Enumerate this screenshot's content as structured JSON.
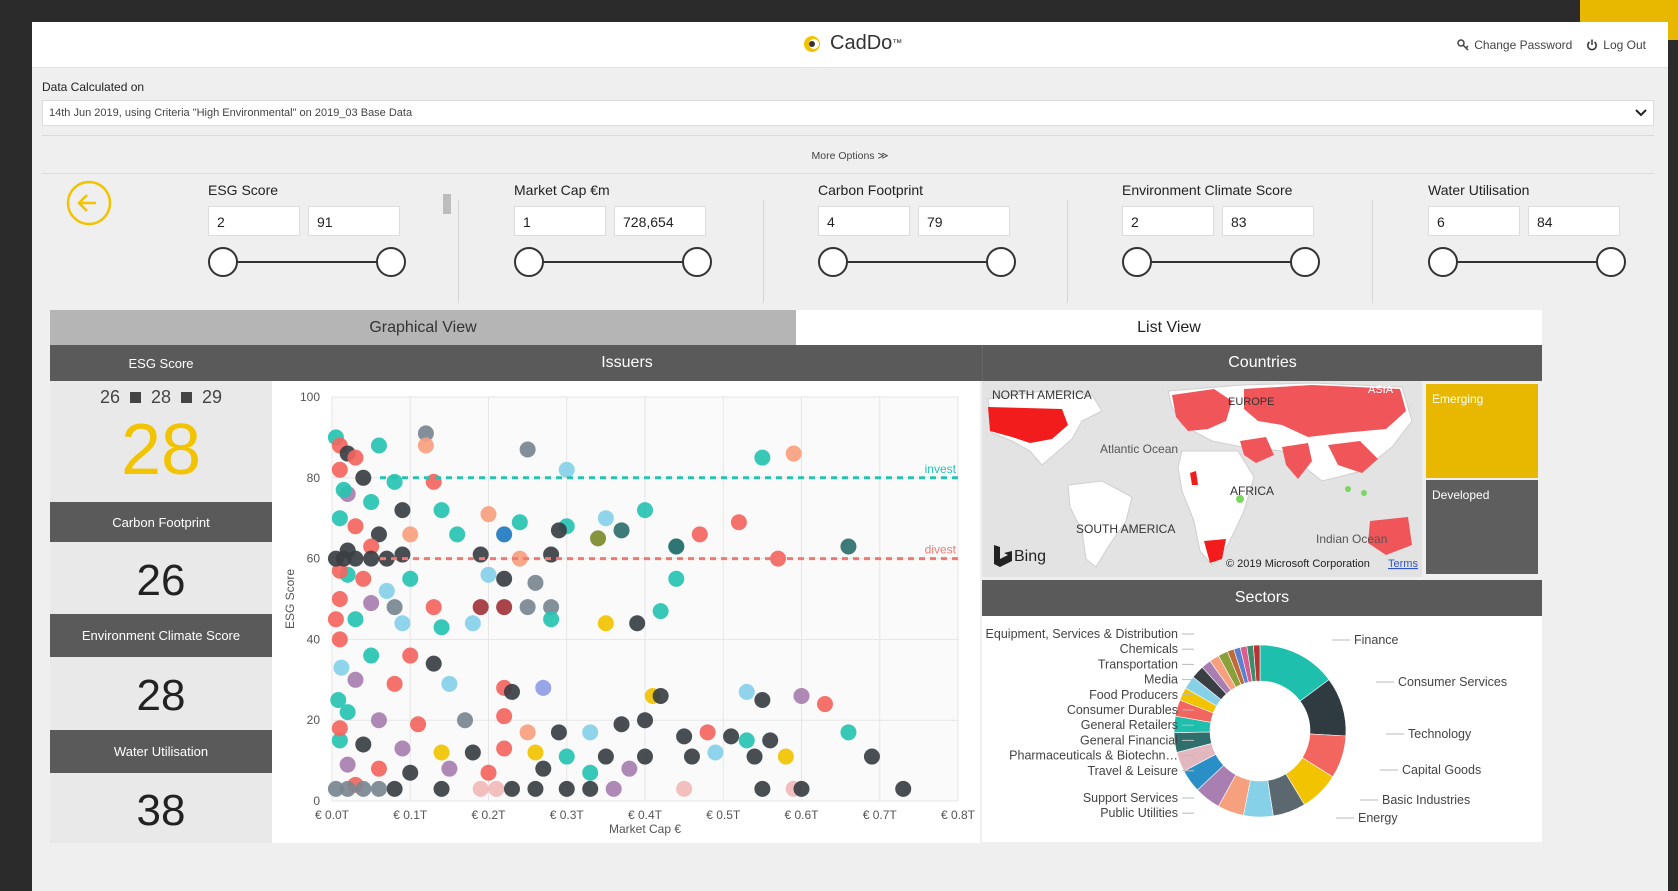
{
  "app": {
    "name": "CadDo",
    "change_password": "Change Password",
    "logout": "Log Out"
  },
  "calc": {
    "label": "Data Calculated on",
    "value": "14th Jun 2019, using Criteria \"High Environmental\" on 2019_03 Base Data",
    "more_options": "More Options ≫"
  },
  "filters": [
    {
      "title": "ESG Score",
      "min": "2",
      "max": "91"
    },
    {
      "title": "Market Cap €m",
      "min": "1",
      "max": "728,654"
    },
    {
      "title": "Carbon Footprint",
      "min": "4",
      "max": "79"
    },
    {
      "title": "Environment Climate Score",
      "min": "2",
      "max": "83"
    },
    {
      "title": "Water Utilisation",
      "min": "6",
      "max": "84"
    }
  ],
  "tabs": {
    "graphical": "Graphical View",
    "list": "List View"
  },
  "headers": {
    "esg": "ESG Score",
    "issuers": "Issuers",
    "countries": "Countries",
    "sectors": "Sectors"
  },
  "scores": {
    "esg_range": [
      "26",
      "28",
      "29"
    ],
    "esg_value": "28",
    "carbon_label": "Carbon Footprint",
    "carbon_value": "26",
    "env_label": "Environment Climate Score",
    "env_value": "28",
    "water_label": "Water Utilisation",
    "water_value": "38"
  },
  "map": {
    "labels": {
      "north_america": "NORTH AMERICA",
      "europe": "EUROPE",
      "asia": "ASIA",
      "atlantic": "Atlantic Ocean",
      "africa": "AFRICA",
      "south_america": "SOUTH AMERICA",
      "indian": "Indian Ocean"
    },
    "bing": "Bing",
    "copyright": "© 2019 Microsoft Corporation",
    "terms": "Terms",
    "emerging": "Emerging",
    "developed": "Developed"
  },
  "colors": {
    "accent": "#f2c300",
    "header_dark": "#5a5a5a",
    "invest": "#27c3b2",
    "divest": "#f07a72",
    "map_highlight": "#f0555a"
  },
  "chart_data": [
    {
      "type": "scatter",
      "title": "",
      "xlabel": "Market Cap €",
      "ylabel": "ESG Score",
      "xlim": [
        0,
        0.8
      ],
      "ylim": [
        0,
        100
      ],
      "x_ticks": [
        "€ 0.0T",
        "€ 0.1T",
        "€ 0.2T",
        "€ 0.3T",
        "€ 0.4T",
        "€ 0.5T",
        "€ 0.6T",
        "€ 0.7T",
        "€ 0.8T"
      ],
      "y_ticks": [
        "0",
        "20",
        "40",
        "60",
        "80",
        "100"
      ],
      "grid": true,
      "reference_lines": [
        {
          "label": "invest",
          "y": 80,
          "color": "#27c3b2"
        },
        {
          "label": "divest",
          "y": 60,
          "color": "#f07a72"
        }
      ],
      "points": [
        [
          0.005,
          90,
          "#27c3b2"
        ],
        [
          0.01,
          88,
          "#f3655f"
        ],
        [
          0.02,
          86,
          "#3a3f44"
        ],
        [
          0.03,
          85,
          "#f3655f"
        ],
        [
          0.06,
          88,
          "#27c3b2"
        ],
        [
          0.12,
          91,
          "#7a8790"
        ],
        [
          0.12,
          88,
          "#f7a07e"
        ],
        [
          0.25,
          87,
          "#7a8790"
        ],
        [
          0.3,
          82,
          "#86d0e8"
        ],
        [
          0.55,
          85,
          "#27c3b2"
        ],
        [
          0.59,
          86,
          "#f7a07e"
        ],
        [
          0.01,
          82,
          "#f3655f"
        ],
        [
          0.04,
          80,
          "#3a3f44"
        ],
        [
          0.08,
          79,
          "#27c3b2"
        ],
        [
          0.13,
          79,
          "#f3655f"
        ],
        [
          0.02,
          76,
          "#a87fb0"
        ],
        [
          0.05,
          74,
          "#27c3b2"
        ],
        [
          0.09,
          72,
          "#3a3f44"
        ],
        [
          0.14,
          72,
          "#27c3b2"
        ],
        [
          0.2,
          71,
          "#f7a07e"
        ],
        [
          0.24,
          69,
          "#27c3b2"
        ],
        [
          0.3,
          68,
          "#27c3b2"
        ],
        [
          0.35,
          70,
          "#86d0e8"
        ],
        [
          0.4,
          72,
          "#27c3b2"
        ],
        [
          0.52,
          69,
          "#f3655f"
        ],
        [
          0.47,
          66,
          "#f3655f"
        ],
        [
          0.01,
          70,
          "#27c3b2"
        ],
        [
          0.03,
          68,
          "#f3655f"
        ],
        [
          0.06,
          66,
          "#3a3f44"
        ],
        [
          0.1,
          66,
          "#f7a07e"
        ],
        [
          0.16,
          66,
          "#27c3b2"
        ],
        [
          0.22,
          66,
          "#1f7ac1"
        ],
        [
          0.29,
          67,
          "#3a3f44"
        ],
        [
          0.34,
          65,
          "#7a8c2e"
        ],
        [
          0.37,
          67,
          "#2e6f6d"
        ],
        [
          0.44,
          63,
          "#27c3b2"
        ],
        [
          0.44,
          63,
          "#2e6f6d"
        ],
        [
          0.66,
          63,
          "#2e6f6d"
        ],
        [
          0.02,
          62,
          "#3a3f44"
        ],
        [
          0.05,
          63,
          "#f3655f"
        ],
        [
          0.09,
          61,
          "#3a3f44"
        ],
        [
          0.19,
          61,
          "#3a3f44"
        ],
        [
          0.24,
          60,
          "#f7a07e"
        ],
        [
          0.28,
          61,
          "#3a3f44"
        ],
        [
          0.57,
          60,
          "#f3655f"
        ],
        [
          0.02,
          56,
          "#27c3b2"
        ],
        [
          0.04,
          55,
          "#f3655f"
        ],
        [
          0.07,
          52,
          "#86d0e8"
        ],
        [
          0.1,
          55,
          "#27c3b2"
        ],
        [
          0.2,
          56,
          "#86d0e8"
        ],
        [
          0.22,
          55,
          "#3a3f44"
        ],
        [
          0.26,
          54,
          "#7a8790"
        ],
        [
          0.44,
          55,
          "#27c3b2"
        ],
        [
          0.01,
          50,
          "#f3655f"
        ],
        [
          0.05,
          49,
          "#a87fb0"
        ],
        [
          0.08,
          48,
          "#7a8790"
        ],
        [
          0.13,
          48,
          "#f3655f"
        ],
        [
          0.19,
          48,
          "#a1343b"
        ],
        [
          0.22,
          48,
          "#a1343b"
        ],
        [
          0.25,
          48,
          "#7a8790"
        ],
        [
          0.28,
          48,
          "#7a8790"
        ],
        [
          0.42,
          47,
          "#27c3b2"
        ],
        [
          0.03,
          45,
          "#27c3b2"
        ],
        [
          0.09,
          44,
          "#86d0e8"
        ],
        [
          0.14,
          43,
          "#27c3b2"
        ],
        [
          0.18,
          44,
          "#86d0e8"
        ],
        [
          0.28,
          45,
          "#27c3b2"
        ],
        [
          0.35,
          44,
          "#f2c300"
        ],
        [
          0.39,
          44,
          "#3a3f44"
        ],
        [
          0.01,
          40,
          "#f3655f"
        ],
        [
          0.05,
          36,
          "#27c3b2"
        ],
        [
          0.1,
          36,
          "#f3655f"
        ],
        [
          0.13,
          34,
          "#3a3f44"
        ],
        [
          0.03,
          30,
          "#a87fb0"
        ],
        [
          0.08,
          29,
          "#f3655f"
        ],
        [
          0.15,
          29,
          "#86d0e8"
        ],
        [
          0.22,
          28,
          "#f3655f"
        ],
        [
          0.27,
          28,
          "#8f9ee6"
        ],
        [
          0.23,
          27,
          "#3a3f44"
        ],
        [
          0.41,
          26,
          "#f2c300"
        ],
        [
          0.42,
          26,
          "#3a3f44"
        ],
        [
          0.53,
          27,
          "#86d0e8"
        ],
        [
          0.55,
          25,
          "#3a3f44"
        ],
        [
          0.6,
          26,
          "#a87fb0"
        ],
        [
          0.63,
          24,
          "#f3655f"
        ],
        [
          0.02,
          22,
          "#27c3b2"
        ],
        [
          0.06,
          20,
          "#a87fb0"
        ],
        [
          0.11,
          19,
          "#f3655f"
        ],
        [
          0.17,
          20,
          "#7a8790"
        ],
        [
          0.22,
          21,
          "#f3655f"
        ],
        [
          0.25,
          17,
          "#f7a07e"
        ],
        [
          0.29,
          17,
          "#3a3f44"
        ],
        [
          0.33,
          17,
          "#86d0e8"
        ],
        [
          0.37,
          19,
          "#3a3f44"
        ],
        [
          0.4,
          20,
          "#3a3f44"
        ],
        [
          0.45,
          16,
          "#3a3f44"
        ],
        [
          0.48,
          17,
          "#f3655f"
        ],
        [
          0.51,
          16,
          "#3a3f44"
        ],
        [
          0.53,
          15,
          "#27c3b2"
        ],
        [
          0.56,
          15,
          "#3a3f44"
        ],
        [
          0.66,
          17,
          "#27c3b2"
        ],
        [
          0.01,
          15,
          "#27c3b2"
        ],
        [
          0.04,
          14,
          "#3a3f44"
        ],
        [
          0.09,
          13,
          "#a87fb0"
        ],
        [
          0.14,
          12,
          "#f2c300"
        ],
        [
          0.18,
          12,
          "#3a3f44"
        ],
        [
          0.22,
          13,
          "#f3655f"
        ],
        [
          0.26,
          12,
          "#f2c300"
        ],
        [
          0.3,
          11,
          "#27c3b2"
        ],
        [
          0.35,
          11,
          "#3a3f44"
        ],
        [
          0.4,
          11,
          "#3a3f44"
        ],
        [
          0.46,
          11,
          "#3a3f44"
        ],
        [
          0.49,
          12,
          "#86d0e8"
        ],
        [
          0.54,
          11,
          "#3a3f44"
        ],
        [
          0.58,
          11,
          "#f2c300"
        ],
        [
          0.69,
          11,
          "#3a3f44"
        ],
        [
          0.02,
          9,
          "#a87fb0"
        ],
        [
          0.06,
          8,
          "#f3655f"
        ],
        [
          0.1,
          7,
          "#3a3f44"
        ],
        [
          0.15,
          8,
          "#a87fb0"
        ],
        [
          0.2,
          7,
          "#f3655f"
        ],
        [
          0.27,
          8,
          "#3a3f44"
        ],
        [
          0.33,
          7,
          "#27c3b2"
        ],
        [
          0.38,
          8,
          "#a87fb0"
        ],
        [
          0.03,
          4,
          "#f3655f"
        ],
        [
          0.08,
          3,
          "#3a3f44"
        ],
        [
          0.14,
          3,
          "#3a3f44"
        ],
        [
          0.19,
          3,
          "#f2b8b8"
        ],
        [
          0.21,
          3,
          "#f2b8b8"
        ],
        [
          0.23,
          3,
          "#3a3f44"
        ],
        [
          0.26,
          3,
          "#3a3f44"
        ],
        [
          0.3,
          3,
          "#3a3f44"
        ],
        [
          0.33,
          3,
          "#3a3f44"
        ],
        [
          0.36,
          3,
          "#a87fb0"
        ],
        [
          0.45,
          3,
          "#f2b8b8"
        ],
        [
          0.55,
          3,
          "#3a3f44"
        ],
        [
          0.59,
          3,
          "#f2b8b8"
        ],
        [
          0.6,
          3,
          "#3a3f44"
        ],
        [
          0.73,
          3,
          "#3a3f44"
        ],
        [
          0.005,
          3,
          "#7a8790"
        ],
        [
          0.02,
          3,
          "#7a8790"
        ],
        [
          0.04,
          3,
          "#7a8790"
        ],
        [
          0.06,
          3,
          "#7a8790"
        ],
        [
          0.01,
          57,
          "#f3655f"
        ],
        [
          0.015,
          77,
          "#27c3b2"
        ],
        [
          0.005,
          45,
          "#f3655f"
        ],
        [
          0.012,
          33,
          "#86d0e8"
        ],
        [
          0.008,
          25,
          "#27c3b2"
        ],
        [
          0.01,
          18,
          "#f3655f"
        ],
        [
          0.005,
          60,
          "#3a3f44"
        ],
        [
          0.015,
          60,
          "#3a3f44"
        ],
        [
          0.03,
          60,
          "#3a3f44"
        ],
        [
          0.05,
          60,
          "#3a3f44"
        ],
        [
          0.07,
          60,
          "#3a3f44"
        ]
      ]
    },
    {
      "type": "pie",
      "title": "",
      "donut": true,
      "labels_left": [
        "Oil Equipment, Services & Distribution",
        "Chemicals",
        "Transportation",
        "Media",
        "Food Producers",
        "Consumer Durables",
        "General Retailers",
        "General Financial",
        "Pharmaceuticals & Biotechn…",
        "Travel & Leisure",
        "Support Services",
        "Public Utilities"
      ],
      "labels_right": [
        "Finance",
        "Consumer Services",
        "Technology",
        "Capital Goods",
        "Basic Industries",
        "Energy"
      ],
      "slices": [
        {
          "name": "Finance",
          "value": 12,
          "color": "#1fbfae"
        },
        {
          "name": "Consumer Services",
          "value": 9,
          "color": "#2f3b40"
        },
        {
          "name": "Technology",
          "value": 6.5,
          "color": "#f3655f"
        },
        {
          "name": "Capital Goods",
          "value": 6,
          "color": "#f2c300"
        },
        {
          "name": "Basic Industries",
          "value": 5,
          "color": "#5c6870"
        },
        {
          "name": "Energy",
          "value": 4.5,
          "color": "#86d0e8"
        },
        {
          "name": "Public Utilities",
          "value": 4,
          "color": "#f7a07e"
        },
        {
          "name": "Support Services",
          "value": 4,
          "color": "#a87fb0"
        },
        {
          "name": "Travel & Leisure",
          "value": 3.5,
          "color": "#2a8fc6"
        },
        {
          "name": "Pharmaceuticals & Biotechn…",
          "value": 3,
          "color": "#e3b7c0"
        },
        {
          "name": "General Financial",
          "value": 3,
          "color": "#2e6f6d"
        },
        {
          "name": "General Retailers",
          "value": 2.5,
          "color": "#1fbfae"
        },
        {
          "name": "Consumer Durables",
          "value": 2.5,
          "color": "#f3655f"
        },
        {
          "name": "Food Producers",
          "value": 2,
          "color": "#f2c300"
        },
        {
          "name": "Media",
          "value": 2,
          "color": "#86d0e8"
        },
        {
          "name": "Transportation",
          "value": 2,
          "color": "#3a3f44"
        },
        {
          "name": "Chemicals",
          "value": 1.5,
          "color": "#a87fb0"
        },
        {
          "name": "Oil Equipment, Services & Distribution",
          "value": 1.5,
          "color": "#f7a07e"
        },
        {
          "name": "",
          "value": 1.5,
          "color": "#8aa13a"
        },
        {
          "name": "",
          "value": 1,
          "color": "#c06a3a"
        },
        {
          "name": "",
          "value": 1,
          "color": "#5b7fd1"
        },
        {
          "name": "",
          "value": 1,
          "color": "#d95d8f"
        },
        {
          "name": "",
          "value": 1,
          "color": "#3d8c6b"
        },
        {
          "name": "",
          "value": 1,
          "color": "#b33"
        }
      ]
    }
  ]
}
